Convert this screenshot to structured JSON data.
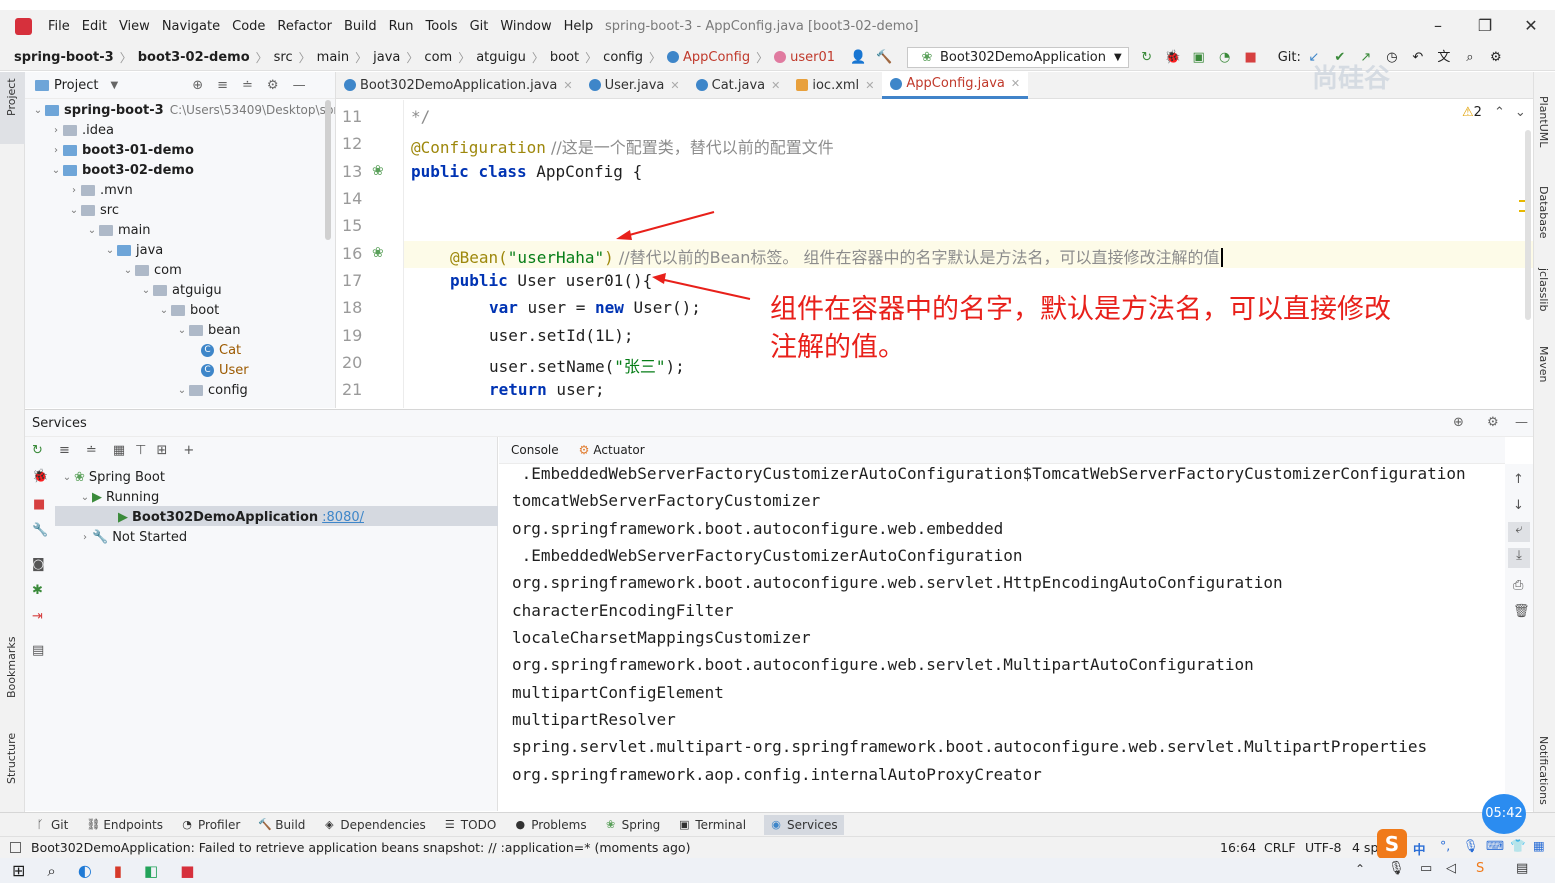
{
  "menu": [
    "File",
    "Edit",
    "View",
    "Navigate",
    "Code",
    "Refactor",
    "Build",
    "Run",
    "Tools",
    "Git",
    "Window",
    "Help"
  ],
  "window_title": "spring-boot-3 - AppConfig.java [boot3-02-demo]",
  "breadcrumbs": [
    "spring-boot-3",
    "boot3-02-demo",
    "src",
    "main",
    "java",
    "com",
    "atguigu",
    "boot",
    "config",
    "AppConfig",
    "user01"
  ],
  "run_config": "Boot302DemoApplication",
  "git_label": "Git:",
  "watermark": "尚硅谷",
  "project_panel": {
    "title": "Project",
    "tree": [
      {
        "label": "spring-boot-3",
        "extra": "C:\\Users\\53409\\Desktop\\sprir"
      },
      {
        "label": ".idea"
      },
      {
        "label": "boot3-01-demo"
      },
      {
        "label": "boot3-02-demo"
      },
      {
        "label": ".mvn"
      },
      {
        "label": "src"
      },
      {
        "label": "main"
      },
      {
        "label": "java"
      },
      {
        "label": "com"
      },
      {
        "label": "atguigu"
      },
      {
        "label": "boot"
      },
      {
        "label": "bean"
      },
      {
        "label": "Cat"
      },
      {
        "label": "User"
      },
      {
        "label": "config"
      }
    ]
  },
  "editor_tabs": [
    "Boot302DemoApplication.java",
    "User.java",
    "Cat.java",
    "ioc.xml",
    "AppConfig.java"
  ],
  "warnings_count": "2",
  "code": {
    "line_numbers": [
      "11",
      "12",
      "13",
      "14",
      "15",
      "16",
      "17",
      "18",
      "19",
      "20",
      "21"
    ],
    "l11": "*/",
    "l12_ann": "@Configuration",
    "l12_cmt": " //这是一个配置类，替代以前的配置文件",
    "l13_kw1": "public",
    "l13_kw2": "class",
    "l13_rest": " AppConfig {",
    "l16_ann": "@Bean(",
    "l16_str": "\"userHaha\"",
    "l16_close": ")",
    "l16_cmt": " //替代以前的Bean标签。 组件在容器中的名字默认是方法名，可以直接修改注解的值",
    "l17_kw": "public",
    "l17_rest": " User user01(){",
    "l18_kw1": "var",
    "l18_mid": " user = ",
    "l18_kw2": "new",
    "l18_rest": " User();",
    "l19": "user.setId(1L);",
    "l20_pre": "user.setName(",
    "l20_str": "\"张三\"",
    "l20_post": ");",
    "l21_kw": "return",
    "l21_rest": " user;"
  },
  "annotation_text": [
    "组件在容器中的名字，默认是方法名，可以直接修改",
    "注解的值。"
  ],
  "services": {
    "title": "Services",
    "tree": [
      {
        "label": "Spring Boot"
      },
      {
        "label": "Running"
      },
      {
        "label": "Boot302DemoApplication",
        "port": ":8080/"
      },
      {
        "label": "Not Started"
      }
    ],
    "console_tabs": [
      "Console",
      "Actuator"
    ],
    "console_lines": [
      " .EmbeddedWebServerFactoryCustomizerAutoConfiguration$TomcatWebServerFactoryCustomizerConfiguration",
      "tomcatWebServerFactoryCustomizer",
      "org.springframework.boot.autoconfigure.web.embedded",
      " .EmbeddedWebServerFactoryCustomizerAutoConfiguration",
      "org.springframework.boot.autoconfigure.web.servlet.HttpEncodingAutoConfiguration",
      "characterEncodingFilter",
      "localeCharsetMappingsCustomizer",
      "org.springframework.boot.autoconfigure.web.servlet.MultipartAutoConfiguration",
      "multipartConfigElement",
      "multipartResolver",
      "spring.servlet.multipart-org.springframework.boot.autoconfigure.web.servlet.MultipartProperties",
      "org.springframework.aop.config.internalAutoProxyCreator"
    ]
  },
  "side_labels": {
    "left": [
      "Project",
      "Bookmarks",
      "Structure"
    ],
    "right": [
      "PlantUML",
      "Database",
      "jclasslib",
      "Maven",
      "Notifications"
    ]
  },
  "bottom_tools": [
    "Git",
    "Endpoints",
    "Profiler",
    "Build",
    "Dependencies",
    "TODO",
    "Problems",
    "Spring",
    "Terminal",
    "Services"
  ],
  "status": {
    "message": "Boot302DemoApplication: Failed to retrieve application beans snapshot: // :application=* (moments ago)",
    "position": "16:64",
    "line_sep": "CRLF",
    "encoding": "UTF-8",
    "indent": "4 spa"
  },
  "timer": "05:42",
  "ime_label": "中"
}
